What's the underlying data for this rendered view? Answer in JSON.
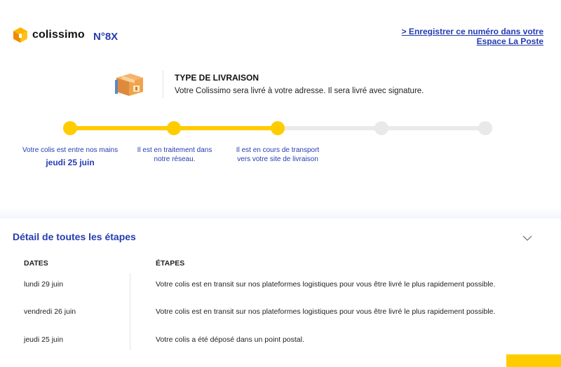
{
  "header": {
    "brand": "colissimo",
    "tracking_number": "N°8X",
    "save_link_line1": "> Enregistrer ce numéro dans votre",
    "save_link_line2": "Espace La Poste"
  },
  "delivery": {
    "icon": "package-icon",
    "title": "TYPE DE LIVRAISON",
    "description": "Votre Colissimo sera livré à votre adresse. Il sera livré avec signature."
  },
  "progress": {
    "completed_steps": 3,
    "total_steps": 5,
    "steps": [
      {
        "label": "Votre colis est entre nos mains",
        "date": "jeudi 25 juin"
      },
      {
        "label": "Il est en traitement dans notre réseau.",
        "date": ""
      },
      {
        "label": "Il est en cours de transport vers votre site de livraison",
        "date": ""
      }
    ]
  },
  "details": {
    "title": "Détail de toutes les étapes",
    "toggle_icon": "chevron-down-icon",
    "columns": {
      "dates": "DATES",
      "steps": "ÉTAPES"
    },
    "rows": [
      {
        "date": "lundi 29 juin",
        "step": "Votre colis est en transit sur nos plateformes logistiques pour vous être livré le plus rapidement possible."
      },
      {
        "date": "vendredi 26 juin",
        "step": "Votre colis est en transit sur nos plateformes logistiques pour vous être livré le plus rapidement possible."
      },
      {
        "date": "jeudi 25 juin",
        "step": "Votre colis a été déposé dans un point postal."
      }
    ]
  },
  "colors": {
    "accent_yellow": "#ffcc00",
    "brand_blue": "#253cb0",
    "inactive_grey": "#ebe8e9"
  }
}
